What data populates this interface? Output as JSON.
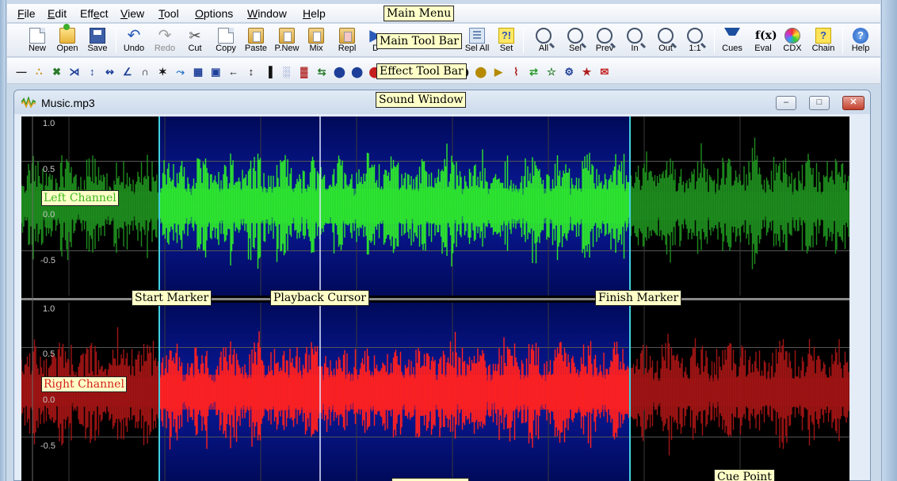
{
  "menu": {
    "items": [
      {
        "pre": "",
        "ul": "F",
        "post": "ile"
      },
      {
        "pre": "",
        "ul": "E",
        "post": "dit"
      },
      {
        "pre": "Eff",
        "ul": "e",
        "post": "ct"
      },
      {
        "pre": "",
        "ul": "V",
        "post": "iew"
      },
      {
        "pre": "",
        "ul": "T",
        "post": "ool"
      },
      {
        "pre": "",
        "ul": "O",
        "post": "ptions"
      },
      {
        "pre": "",
        "ul": "W",
        "post": "indow"
      },
      {
        "pre": "",
        "ul": "H",
        "post": "elp"
      }
    ]
  },
  "toolbar": {
    "new": "New",
    "open": "Open",
    "save": "Save",
    "undo": "Undo",
    "redo": "Redo",
    "cut": "Cut",
    "copy": "Copy",
    "paste": "Paste",
    "paste_new": "P.New",
    "mix": "Mix",
    "replace": "Repl",
    "delete": "D",
    "sel_all": "Sel All",
    "set": "Set",
    "zoom_all": "All",
    "zoom_sel": "Sel",
    "zoom_prev": "Prev",
    "zoom_in": "In",
    "zoom_out": "Out",
    "zoom_1_1": "1:1",
    "cues": "Cues",
    "eval": "Eval",
    "cdx": "CDX",
    "chain": "Chain",
    "help": "Help"
  },
  "icons": {
    "cues_glyph": "…",
    "fx_glyph": "f(x)",
    "chain_glyph": "?",
    "help_glyph": "?",
    "select_glyph": "?!",
    "scissors_glyph": "✂"
  },
  "effects": [
    "—",
    "∴",
    "✖",
    "⋊",
    "↕",
    "↭",
    "∠",
    "∩",
    "✶",
    "⤳",
    "▦",
    "▣",
    "←",
    "↕",
    "▐",
    "░",
    "▓",
    "⇆",
    "⬤",
    "⬤",
    "⬤",
    "⬤",
    "⬤",
    "⬤",
    "⬤",
    "⬤",
    "⬤",
    "▶",
    "⌇",
    "⇄",
    "☆",
    "⚙",
    "★",
    "✉"
  ],
  "callouts": {
    "main_menu": "Main Menu",
    "main_toolbar": "Main Tool Bar",
    "effect_toolbar": "Effect Tool Bar",
    "sound_window": "Sound Window",
    "start_marker": "Start Marker",
    "playback_cursor": "Playback Cursor",
    "finish_marker": "Finish Marker",
    "cue_point": "Cue Point"
  },
  "sound_window": {
    "file_name": "Music.mp3",
    "minimize_glyph": "–",
    "maximize_glyph": "□",
    "close_glyph": "✕",
    "left_channel_label": "Left Channel",
    "right_channel_label": "Right Channel",
    "left_ticks": [
      "1.0",
      "0.5",
      "0.0",
      "-0.5"
    ],
    "right_ticks": [
      "1.0",
      "0.5",
      "0.0",
      "-0.5"
    ]
  },
  "colors": {
    "selection_bg": "#0a1a9c",
    "left_selected": "#2ee62e",
    "left_unselected": "#1e8c1e",
    "right_selected": "#ff2020",
    "right_unselected": "#a01414",
    "marker_line": "#3fd1e0"
  }
}
